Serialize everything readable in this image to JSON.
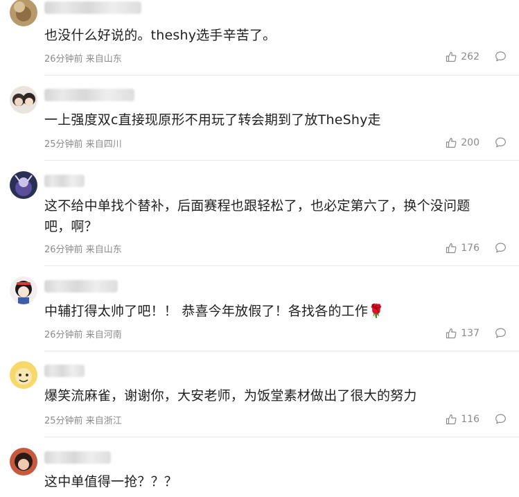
{
  "comments": [
    {
      "text": "也没什么好说的。theshy选手辛苦了。",
      "time": "26分钟前",
      "location": "来自山东",
      "likes": "262"
    },
    {
      "text": "一上强度双c直接现原形不用玩了转会期到了放TheShy走",
      "time": "25分钟前",
      "location": "来自四川",
      "likes": "200"
    },
    {
      "text": "这不给中单找个替补，后面赛程也跟轻松了，也必定第六了，换个没问题吧，啊？",
      "time": "26分钟前",
      "location": "来自山东",
      "likes": "176"
    },
    {
      "text": "中辅打得太帅了吧！！ 恭喜今年放假了！各找各的工作🌹",
      "time": "26分钟前",
      "location": "来自河南",
      "likes": "137"
    },
    {
      "text": "爆笑流麻雀，谢谢你，大安老师，为饭堂素材做出了很大的努力",
      "time": "25分钟前",
      "location": "来自浙江",
      "likes": "116"
    },
    {
      "text": "这中单值得一抢？？？",
      "time": "",
      "location": "",
      "likes": ""
    }
  ],
  "icons": {
    "like": "thumbs-up-icon",
    "reply": "comment-bubble-icon"
  },
  "colors": {
    "meta_text": "#8a8a8a",
    "divider": "#e8e8e8"
  }
}
